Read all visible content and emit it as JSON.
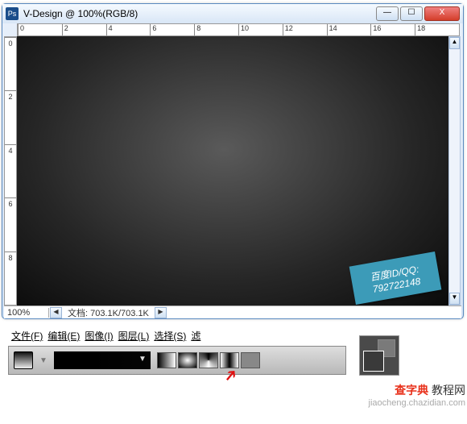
{
  "window": {
    "title": "V-Design @ 100%(RGB/8)",
    "btn_min": "—",
    "btn_max": "☐",
    "btn_close": "X"
  },
  "ruler_h": [
    "0",
    "2",
    "4",
    "6",
    "8",
    "10",
    "12",
    "14",
    "16",
    "18"
  ],
  "ruler_v": [
    "0",
    "2",
    "4",
    "6",
    "8"
  ],
  "sticker": {
    "line1": "百度ID/QQ:",
    "line2": "792722148"
  },
  "scroll": {
    "up": "▲",
    "down": "▼",
    "left": "◀",
    "right": "▶"
  },
  "status": {
    "zoom": "100%",
    "docinfo": "文档: 703.1K/703.1K"
  },
  "menus": [
    "文件(F)",
    "编辑(E)",
    "图像(I)",
    "图层(L)",
    "选择(S)",
    "滤"
  ],
  "caption": {
    "brand": "查字典",
    "suffix": " 教程网",
    "url": "jiaocheng.chazidian.com"
  }
}
